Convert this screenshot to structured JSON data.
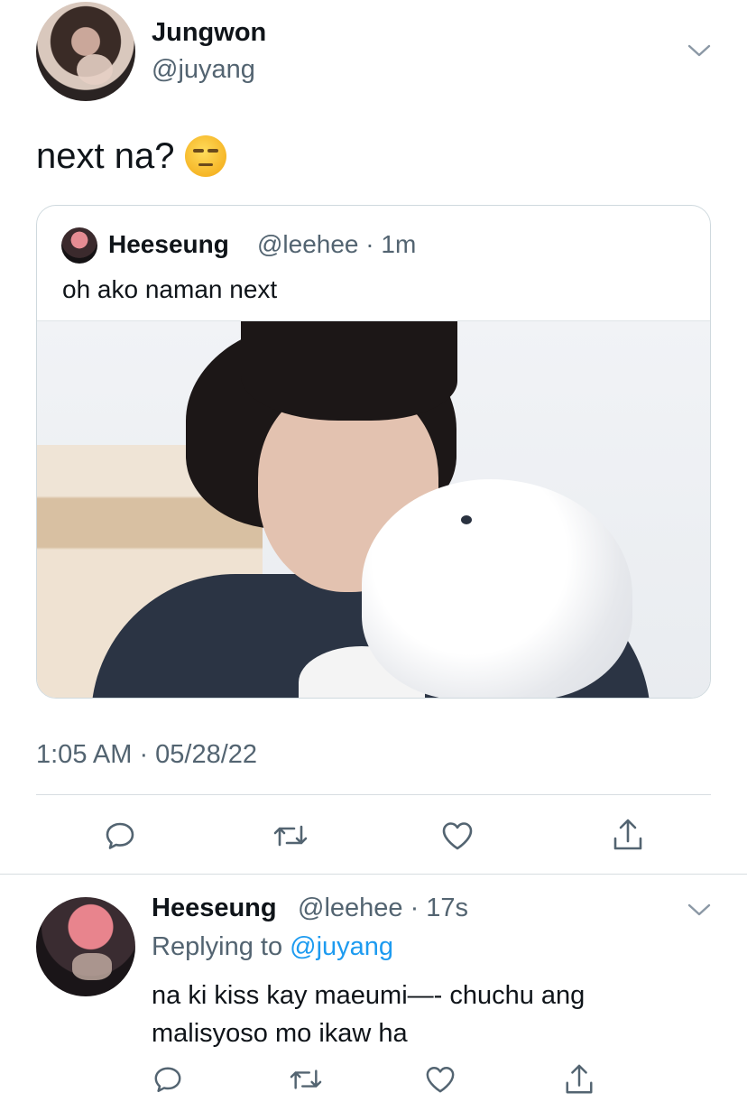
{
  "tweet": {
    "author": {
      "name": "Jungwon",
      "handle": "@juyang"
    },
    "text": "next na?",
    "emoji": "unamused-face-emoji",
    "timestamp": "1:05 AM · 05/28/22"
  },
  "quoted_tweet": {
    "author": {
      "name": "Heeseung",
      "handle": "@leehee"
    },
    "meta": "@leehee · 1m",
    "text": "oh ako naman next"
  },
  "actions": {
    "icons": [
      "reply-icon",
      "retweet-icon",
      "like-icon",
      "share-icon"
    ]
  },
  "reply": {
    "author": {
      "name": "Heeseung"
    },
    "meta": "@leehee · 17s",
    "replying_prefix": "Replying to",
    "replying_to": "@juyang",
    "text": "na ki kiss kay maeumi—- chuchu ang malisyoso mo ikaw ha"
  },
  "colors": {
    "text": "#0f1419",
    "secondary": "#536471",
    "link": "#1d9bf0",
    "border": "#cfd9de"
  }
}
